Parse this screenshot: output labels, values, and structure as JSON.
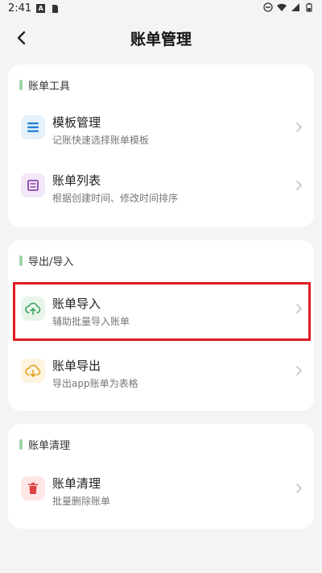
{
  "status": {
    "time": "2:41"
  },
  "header": {
    "title": "账单管理"
  },
  "sections": [
    {
      "title": "账单工具",
      "items": [
        {
          "title": "模板管理",
          "subtitle": "记账快速选择账单模板",
          "icon": "list-icon",
          "color": "#1e7fd6",
          "bg": "#e6f1fb"
        },
        {
          "title": "账单列表",
          "subtitle": "根据创建时间、修改时间排序",
          "icon": "document-list-icon",
          "color": "#8e44ad",
          "bg": "#f3e8f8"
        }
      ]
    },
    {
      "title": "导出/导入",
      "items": [
        {
          "title": "账单导入",
          "subtitle": "辅助批量导入账单",
          "icon": "cloud-upload-icon",
          "color": "#3aa35a",
          "bg": "#e7f5eb"
        },
        {
          "title": "账单导出",
          "subtitle": "导出app账单为表格",
          "icon": "cloud-download-icon",
          "color": "#e0a11b",
          "bg": "#fdf3df"
        }
      ]
    },
    {
      "title": "账单清理",
      "items": [
        {
          "title": "账单清理",
          "subtitle": "批量删除账单",
          "icon": "trash-icon",
          "color": "#e04343",
          "bg": "#fde7e7"
        }
      ]
    }
  ],
  "colors": {
    "accent_bar": "#9fd6a8",
    "highlight": "#e01b24"
  }
}
